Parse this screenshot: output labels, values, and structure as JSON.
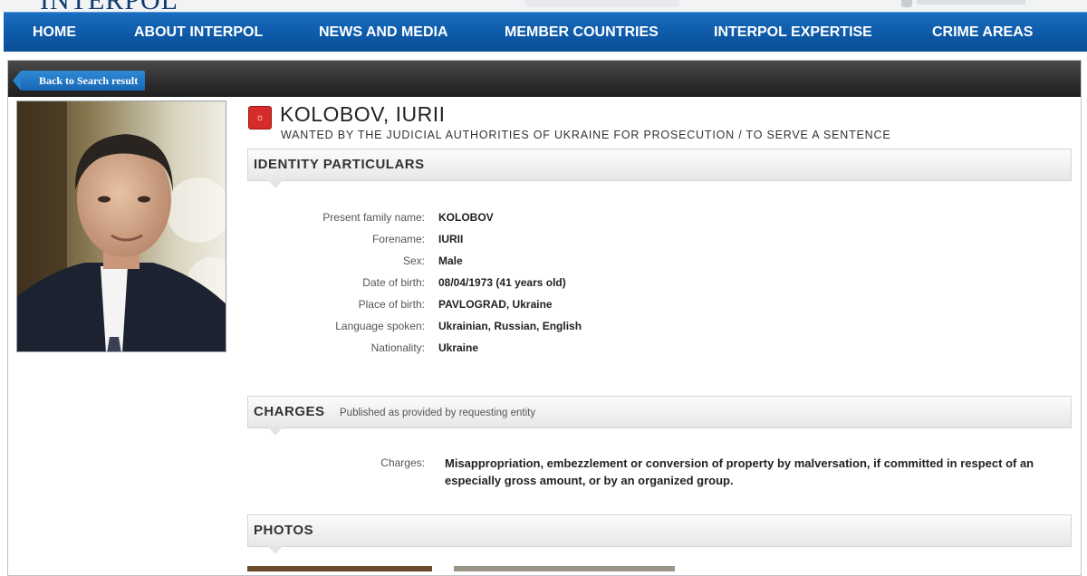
{
  "brand": {
    "logo_text": "INTERPOL"
  },
  "nav": {
    "items": [
      "HOME",
      "ABOUT INTERPOL",
      "NEWS AND MEDIA",
      "MEMBER COUNTRIES",
      "INTERPOL EXPERTISE",
      "CRIME AREAS"
    ]
  },
  "back_button": {
    "label": "Back to Search result"
  },
  "notice": {
    "name": "KOLOBOV, IURII",
    "subtitle": "WANTED BY THE JUDICIAL AUTHORITIES OF UKRAINE FOR PROSECUTION / TO SERVE A SENTENCE"
  },
  "identity": {
    "heading": "IDENTITY PARTICULARS",
    "fields": [
      {
        "label": "Present family name:",
        "value": "KOLOBOV"
      },
      {
        "label": "Forename:",
        "value": "IURII"
      },
      {
        "label": "Sex:",
        "value": "Male"
      },
      {
        "label": "Date of birth:",
        "value": "08/04/1973 (41 years old)"
      },
      {
        "label": "Place of birth:",
        "value": "PAVLOGRAD, Ukraine"
      },
      {
        "label": "Language spoken:",
        "value": "Ukrainian, Russian, English"
      },
      {
        "label": "Nationality:",
        "value": "Ukraine"
      }
    ]
  },
  "charges": {
    "heading": "CHARGES",
    "note": "Published as provided by requesting entity",
    "label": "Charges:",
    "text": "Misappropriation, embezzlement or conversion of property by malversation, if committed in respect of an especially gross amount, or by an organized group."
  },
  "photos": {
    "heading": "PHOTOS"
  },
  "colors": {
    "nav_blue": "#0d5aa8",
    "notice_red": "#d52b2b",
    "topbar_dark": "#2d2d2d"
  },
  "icons": [
    "red-notice-icon",
    "back-arrow-icon"
  ]
}
